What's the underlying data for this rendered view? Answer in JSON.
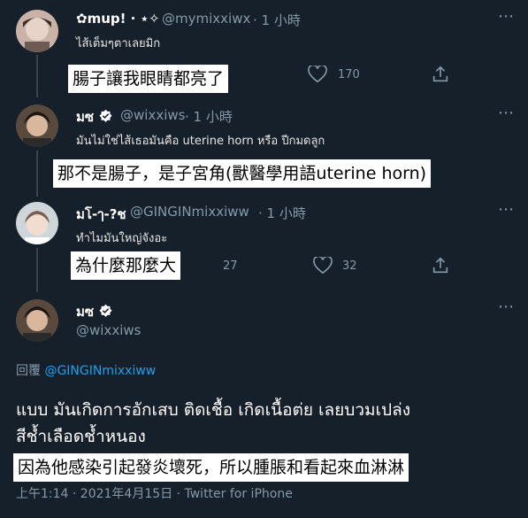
{
  "tweets": [
    {
      "display_name": "✿mup! · ⋆✧",
      "handle": "@mymixxiwx",
      "time": "· 1 小時",
      "text": "ไส้เต็มๆตาเลยมิก",
      "caption": "腸子讓我眼睛都亮了",
      "likes": "170",
      "verified": false
    },
    {
      "display_name": "มซ",
      "handle": "@wixxiws",
      "time": "· 1 小時",
      "text": "มันไม่ใช่ไส้เธอมันคือ uterine horn หรือ ปีกมดลูก",
      "caption": "那不是腸子，是子宮角(獸醫學用語uterine horn)",
      "verified": true
    },
    {
      "display_name": "มโ-ๅ-?ช",
      "handle": "@GINGINmixxiww",
      "time": "· 1 小時",
      "text": "ทำไมมันใหญ่จังอะ",
      "caption": "為什麼那麼大",
      "replies": "27",
      "likes": "32",
      "verified": false
    }
  ],
  "main_tweet": {
    "display_name": "มซ",
    "handle": "@wixxiws",
    "reply_label": "回覆",
    "reply_to": "@GINGINmixxiww",
    "text_line1": "แบบ มันเกิดการอักเสบ ติดเชื้อ เกิดเนื้อต่ย เลยบวมเปล่ง",
    "text_line2": "สีช้ำเลือดช้ำหนอง",
    "caption": "因為他感染引起發炎壞死，所以腫脹和看起來血淋淋",
    "meta": "上午1:14 · 2021年4月15日 · Twitter for iPhone"
  },
  "icons": [
    "more-icon",
    "heart-icon",
    "share-icon",
    "reply-icon",
    "retweet-icon",
    "verified-badge-icon"
  ],
  "colors": {
    "background": "#15202b",
    "link": "#1da1f2",
    "muted": "#8899a6",
    "caption_bg": "#ffffff"
  }
}
